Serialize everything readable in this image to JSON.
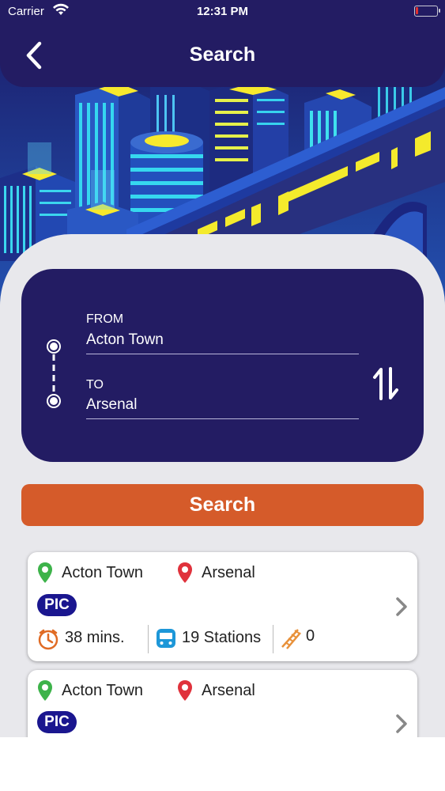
{
  "status_bar": {
    "carrier": "Carrier",
    "time": "12:31 PM"
  },
  "header": {
    "title": "Search"
  },
  "route": {
    "from_label": "FROM",
    "from_value": "Acton Town",
    "to_label": "TO",
    "to_value": "Arsenal"
  },
  "search_button": "Search",
  "results": [
    {
      "from": "Acton Town",
      "to": "Arsenal",
      "line": "PIC",
      "duration": "38 mins.",
      "stations": "19 Stations",
      "changes": "0"
    },
    {
      "from": "Acton Town",
      "to": "Arsenal",
      "line": "PIC"
    }
  ],
  "icons": {
    "back": "chevron-left-icon",
    "swap": "swap-arrows-icon",
    "from_pin": "map-pin-green-icon",
    "to_pin": "map-pin-red-icon",
    "clock": "clock-icon",
    "train": "train-icon",
    "escalator": "escalator-icon",
    "chevron": "chevron-right-icon"
  },
  "colors": {
    "header_bg": "#231c63",
    "accent_orange": "#d55b2a",
    "line_badge": "#1a168f",
    "pin_green": "#3db34a",
    "pin_red": "#e0323c"
  }
}
